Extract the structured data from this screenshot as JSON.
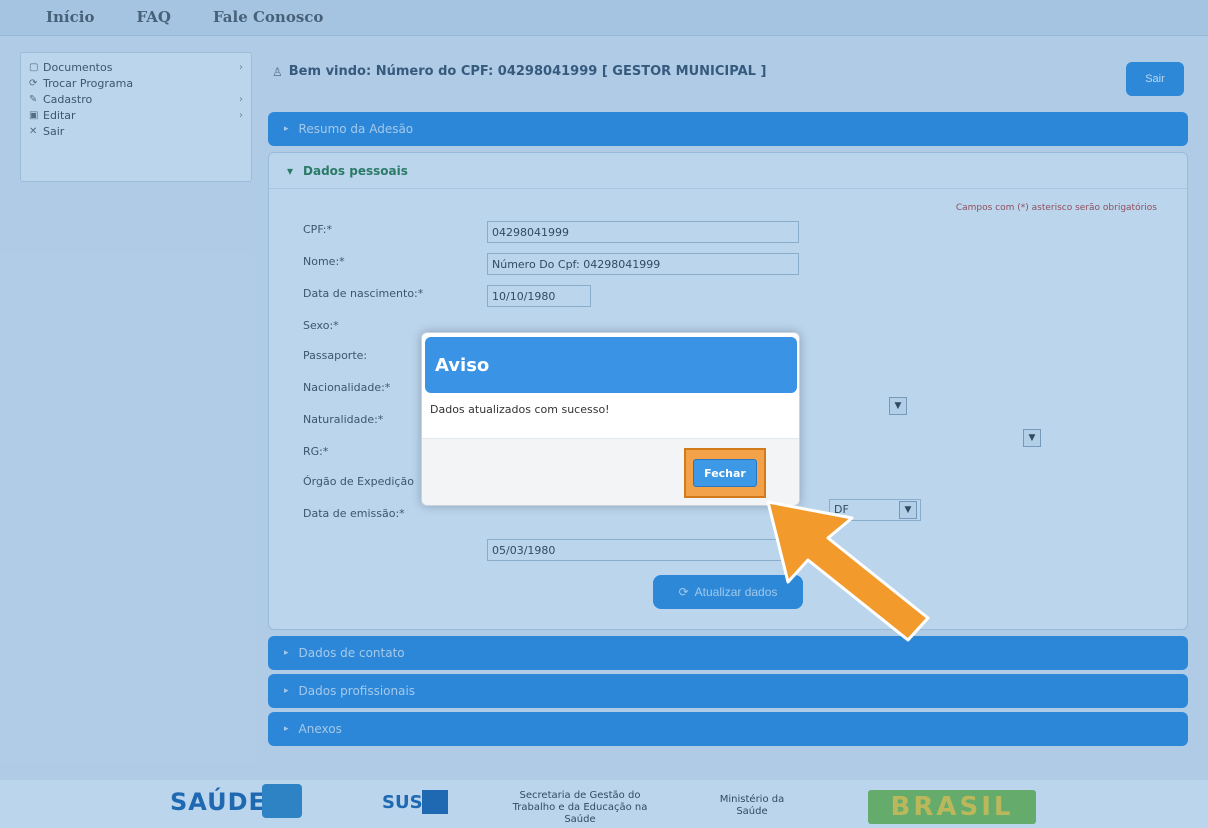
{
  "topnav": {
    "inicio": "Início",
    "faq": "FAQ",
    "contato": "Fale Conosco"
  },
  "sidebar": {
    "items": [
      {
        "label": "Documentos",
        "icon": "document-icon",
        "chevron": "›"
      },
      {
        "label": "Trocar Programa",
        "icon": "swap-icon",
        "chevron": ""
      },
      {
        "label": "Cadastro",
        "icon": "pencil-icon",
        "chevron": "›"
      },
      {
        "label": "Editar",
        "icon": "edit-icon",
        "chevron": "›"
      },
      {
        "label": "Sair",
        "icon": "close-icon",
        "chevron": ""
      }
    ]
  },
  "header": {
    "welcome": "Bem vindo: Número do CPF: 04298041999 [ GESTOR MUNICIPAL ]",
    "logout_label": "Sair"
  },
  "accordion": {
    "resumo": "Resumo da Adesão",
    "dados_pessoais": "Dados pessoais",
    "dados_contato": "Dados de contato",
    "dados_profissionais": "Dados profissionais",
    "anexos": "Anexos"
  },
  "form": {
    "required_note": "Campos com (*) asterisco serão obrigatórios",
    "labels": {
      "cpf": "CPF:*",
      "nome": "Nome:*",
      "nascimento": "Data de nascimento:*",
      "sexo": "Sexo:*",
      "passaporte": "Passaporte:",
      "nacionalidade": "Nacionalidade:*",
      "naturalidade": "Naturalidade:*",
      "rg": "RG:*",
      "orgao": "Órgão de Expedição",
      "emissao": "Data de emissão:*"
    },
    "values": {
      "cpf": "04298041999",
      "nome": "Número Do Cpf: 04298041999",
      "nascimento": "10/10/1980",
      "orgao_uf": "DF",
      "emissao": "05/03/1980"
    },
    "submit_label": "Atualizar dados"
  },
  "dialog": {
    "title": "Aviso",
    "message": "Dados atualizados com sucesso!",
    "close_label": "Fechar"
  },
  "footer": {
    "saude": "SAÚDE",
    "sus": "SUS",
    "secretaria": "Secretaria de Gestão do Trabalho e da Educação na Saúde",
    "ministerio": "Ministério da Saúde",
    "brasil": "BRASIL"
  },
  "colors": {
    "accent": "#2e8de0",
    "arrow": "#f39a2d",
    "success": "#2b7a3a"
  }
}
